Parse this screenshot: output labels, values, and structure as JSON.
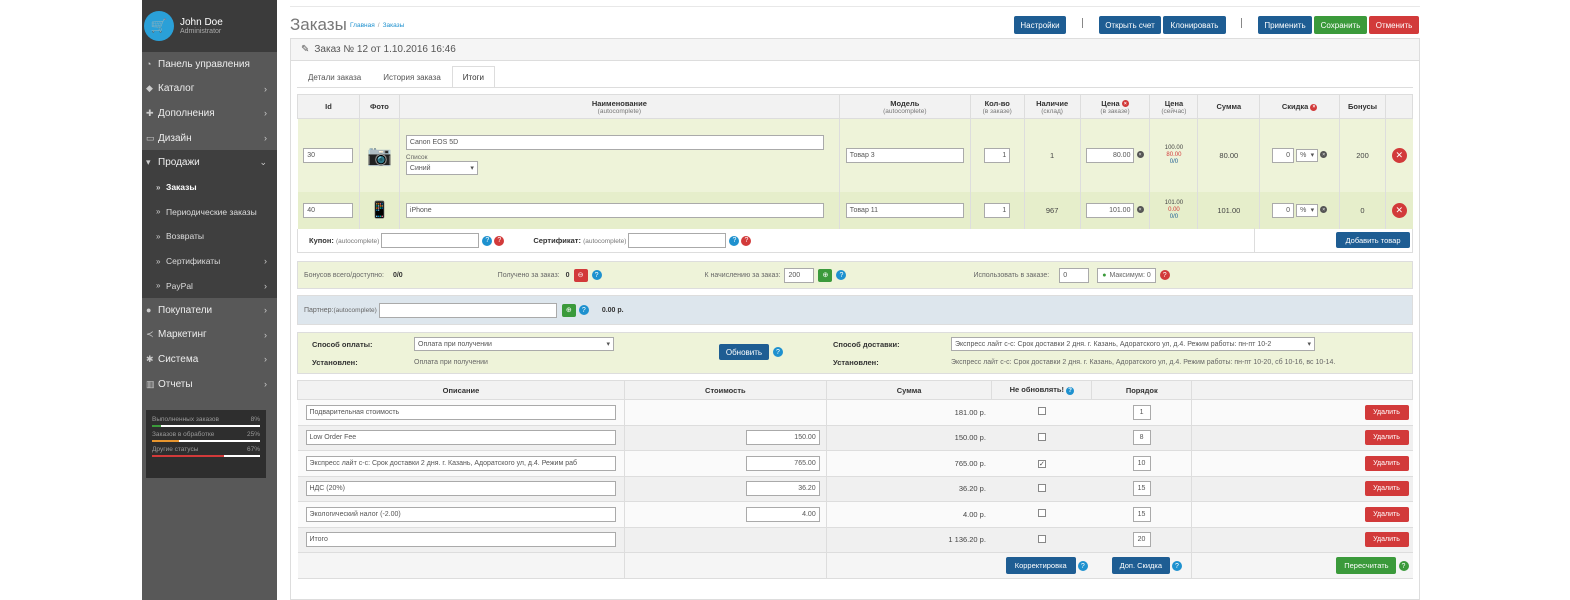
{
  "sidebar": {
    "user": {
      "name": "John Doe",
      "role": "Administrator"
    },
    "menu": [
      {
        "label": "Панель управления",
        "icon": "dashboard-icon",
        "chevron": false
      },
      {
        "label": "Каталог",
        "icon": "tag-icon",
        "chevron": true
      },
      {
        "label": "Дополнения",
        "icon": "puzzle-icon",
        "chevron": true
      },
      {
        "label": "Дизайн",
        "icon": "monitor-icon",
        "chevron": true
      },
      {
        "label": "Продажи",
        "icon": "cart-icon",
        "chevron": true
      },
      {
        "label": "Заказы",
        "icon": "double-chevron-icon",
        "chevron": false
      },
      {
        "label": "Периодические заказы",
        "icon": "double-chevron-icon",
        "chevron": false
      },
      {
        "label": "Возвраты",
        "icon": "double-chevron-icon",
        "chevron": false
      },
      {
        "label": "Сертификаты",
        "icon": "double-chevron-icon",
        "chevron": true
      },
      {
        "label": "PayPal",
        "icon": "double-chevron-icon",
        "chevron": true
      },
      {
        "label": "Покупатели",
        "icon": "user-icon",
        "chevron": true
      },
      {
        "label": "Маркетинг",
        "icon": "share-icon",
        "chevron": true
      },
      {
        "label": "Система",
        "icon": "cog-icon",
        "chevron": true
      },
      {
        "label": "Отчеты",
        "icon": "bar-chart-icon",
        "chevron": true
      }
    ],
    "stats": [
      {
        "label": "Выполненных заказов",
        "value": "8%",
        "fraction": 0.08,
        "color": "#3b9a3b"
      },
      {
        "label": "Заказов в обработке",
        "value": "25%",
        "fraction": 0.25,
        "color": "#e7952e"
      },
      {
        "label": "Другие статусы",
        "value": "67%",
        "fraction": 0.67,
        "color": "#d23a3a"
      }
    ]
  },
  "header": {
    "title": "Заказы",
    "breadcrumb": [
      "Главная",
      "Заказы"
    ],
    "buttons": {
      "settings": "Настройки",
      "invoice": "Открыть счет",
      "clone": "Клонировать",
      "apply": "Применить",
      "save": "Сохранить",
      "cancel": "Отменить"
    }
  },
  "order": {
    "heading": "Заказ № 12 от 1.10.2016 16:46",
    "tabs": [
      "Детали заказа",
      "История заказа",
      "Итоги"
    ],
    "columns": {
      "id": "Id",
      "photo": "Фото",
      "name": "Наименование",
      "name_sub": "(autocomplete)",
      "model": "Модель",
      "model_sub": "(autocomplete)",
      "qty": "Кол-во",
      "qty_sub": "(в заказе)",
      "stock": "Наличие",
      "stock_sub": "(склад)",
      "price": "Цена",
      "price_sub": "(в заказе)",
      "price_now": "Цена",
      "price_now_sub": "(сейчас)",
      "sum": "Сумма",
      "discount": "Скидка",
      "bonus": "Бонусы"
    },
    "products": [
      {
        "id": "30",
        "name": "Canon EOS 5D",
        "option_label": "Список",
        "option_value": "Синий",
        "model": "Товар 3",
        "qty": "1",
        "stock": "1",
        "price": "80.00",
        "now1": "100.00",
        "now2": "80.00",
        "now3": "0/0",
        "sum": "80.00",
        "discount": "0",
        "discount_type": "%",
        "bonus": "200"
      },
      {
        "id": "40",
        "name": "iPhone",
        "model": "Товар 11",
        "qty": "1",
        "stock": "967",
        "price": "101.00",
        "now1": "101.00",
        "now2": "0.00",
        "now3": "0/0",
        "sum": "101.00",
        "discount": "0",
        "discount_type": "%",
        "bonus": "0"
      }
    ],
    "coupon_label": "Купон:",
    "cert_label": "Сертификат:",
    "autocomplete": "(autocomplete)",
    "add_product": "Добавить товар",
    "bonus": {
      "total_label": "Бонусов всего/доступно:",
      "total_value": "0/0",
      "received_label": "Получено за заказ:",
      "received_value": "0",
      "accrue_label": "К начислению за заказ:",
      "accrue_value": "200",
      "use_label": "Использовать в заказе:",
      "use_value": "0",
      "max_label": "Максимум: 0"
    },
    "partner": {
      "label": "Партнер:",
      "sub": "(autocomplete)",
      "amount": "0.00 р."
    },
    "payment": {
      "label": "Способ оплаты:",
      "value": "Оплата при получении",
      "set_label": "Установлен:",
      "set_value": "Оплата при получении",
      "refresh": "Обновить"
    },
    "shipping": {
      "label": "Способ доставки:",
      "value": "Экспресс лайт с-с: Срок доставки 2 дня. г. Казань, Адоратского ул, д.4. Режим работы: пн-пт 10-2",
      "set_label": "Установлен:",
      "set_value": "Экспресс лайт с-с: Срок доставки 2 дня. г. Казань, Адоратского ул, д.4. Режим работы: пн-пт 10-20, сб 10-16, вс 10-14."
    },
    "totals_cols": {
      "desc": "Описание",
      "cost": "Стоимость",
      "sum": "Сумма",
      "noupdate": "Не обновлять!",
      "order": "Порядок"
    },
    "totals": [
      {
        "desc": "Подварительная стоимость",
        "cost": "",
        "sum": "181.00 р.",
        "checked": false,
        "order": "1"
      },
      {
        "desc": "Low Order Fee",
        "cost": "150.00",
        "sum": "150.00 р.",
        "checked": false,
        "order": "8"
      },
      {
        "desc": "Экспресс лайт с-с: Срок доставки 2 дня. г. Казань, Адоратского ул, д.4. Режим раб",
        "cost": "765.00",
        "sum": "765.00 р.",
        "checked": true,
        "order": "10"
      },
      {
        "desc": "НДС (20%)",
        "cost": "36.20",
        "sum": "36.20 р.",
        "checked": false,
        "order": "15"
      },
      {
        "desc": "Экологический налог (-2.00)",
        "cost": "4.00",
        "sum": "4.00 р.",
        "checked": false,
        "order": "15"
      },
      {
        "desc": "Итого",
        "cost": "",
        "sum": "1 136.20 р.",
        "checked": false,
        "order": "20"
      }
    ],
    "delete": "Удалить",
    "adjust": "Корректировка",
    "extra_discount": "Доп. Скидка",
    "recalc": "Пересчитать"
  }
}
